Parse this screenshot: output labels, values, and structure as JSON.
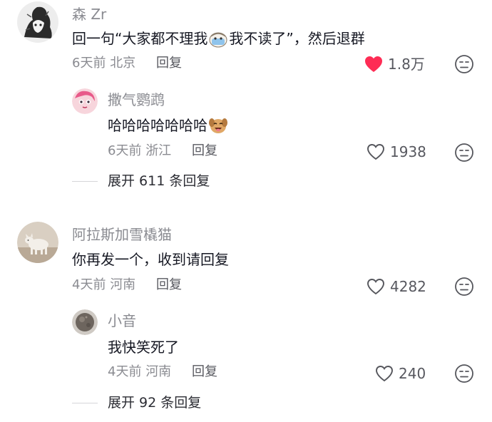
{
  "comments": [
    {
      "author": "森 Zr",
      "text_before": "回一句“大家都不理我",
      "emoji": "crying-face-emoji",
      "text_after": "我不读了”，然后退群",
      "time": "6天前",
      "location": "北京",
      "reply_label": "回复",
      "likes": "1.8万",
      "liked": true,
      "replies": [
        {
          "author": "撒气鹦鹉",
          "text": "哈哈哈哈哈哈哈",
          "emoji": "dog-laughing-emoji",
          "time": "6天前",
          "location": "浙江",
          "reply_label": "回复",
          "likes": "1938"
        }
      ],
      "expand_label": "展开 611 条回复"
    },
    {
      "author": "阿拉斯加雪橇猫",
      "text": "你再发一个，收到请回复",
      "time": "4天前",
      "location": "河南",
      "reply_label": "回复",
      "likes": "4282",
      "liked": false,
      "replies": [
        {
          "author": "小音",
          "text": "我快笑死了",
          "time": "4天前",
          "location": "河南",
          "reply_label": "回复",
          "likes": "240"
        }
      ],
      "expand_label": "展开 92 条回复"
    }
  ],
  "colors": {
    "liked_heart": "#fe2c55",
    "secondary_text": "#8a8b91",
    "primary_text": "#161823"
  }
}
